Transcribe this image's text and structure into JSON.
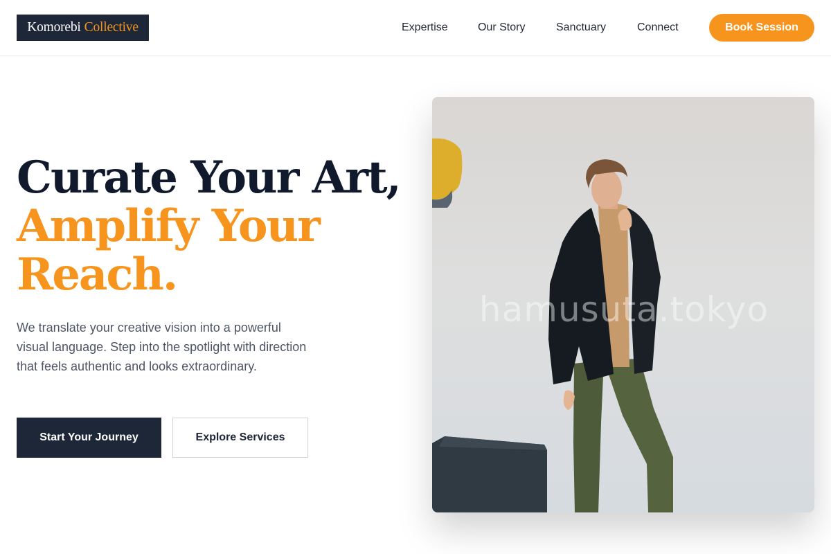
{
  "brand": {
    "name": "Komorebi",
    "accent": "Collective"
  },
  "nav": {
    "links": [
      "Expertise",
      "Our Story",
      "Sanctuary",
      "Connect"
    ],
    "cta": "Book Session"
  },
  "hero": {
    "headline_line1": "Curate Your Art,",
    "headline_line2": "Amplify Your",
    "headline_line3": "Reach.",
    "description": "We translate your creative vision into a powerful visual language. Step into the spotlight with direction that feels authentic and looks extraordinary.",
    "primary_button": "Start Your Journey",
    "secondary_button": "Explore Services"
  },
  "image": {
    "watermark": "hamusuta.tokyo"
  },
  "colors": {
    "navy": "#1e2738",
    "accent": "#f7941d",
    "body_text": "#4d5564"
  }
}
